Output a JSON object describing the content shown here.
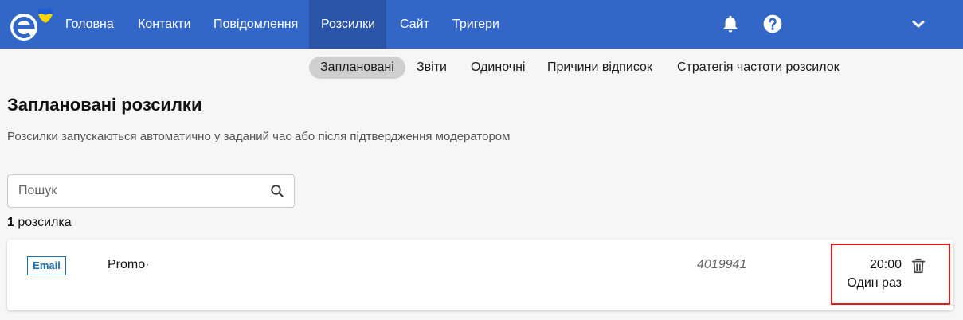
{
  "nav": {
    "items": [
      {
        "label": "Головна"
      },
      {
        "label": "Контакти"
      },
      {
        "label": "Повідомлення"
      },
      {
        "label": "Розсилки"
      },
      {
        "label": "Сайт"
      },
      {
        "label": "Тригери"
      }
    ],
    "active": "Розсилки",
    "icons": [
      "bell-icon",
      "help-icon",
      "chevron-down-icon"
    ]
  },
  "subtabs": [
    {
      "label": "Заплановані"
    },
    {
      "label": "Звіти"
    },
    {
      "label": "Одиночні"
    },
    {
      "label": "Причини відписок"
    },
    {
      "label": "Стратегія частоти розсилок"
    }
  ],
  "page": {
    "title": "Заплановані розсилки",
    "description": "Розсилки запускаються автоматично у заданий час або після підтвердження модератором"
  },
  "search": {
    "placeholder": "Пошук",
    "value": ""
  },
  "count": {
    "number": "1",
    "label": "розсилка"
  },
  "rows": [
    {
      "type": "Email",
      "name": "Promo·",
      "id": "4019941",
      "time": "20:00",
      "frequency": "Один раз"
    }
  ],
  "colors": {
    "topbar": "#3267c8",
    "topbar_active": "#2954a8",
    "badge": "#1c6fab",
    "highlight": "#e01b1b"
  }
}
